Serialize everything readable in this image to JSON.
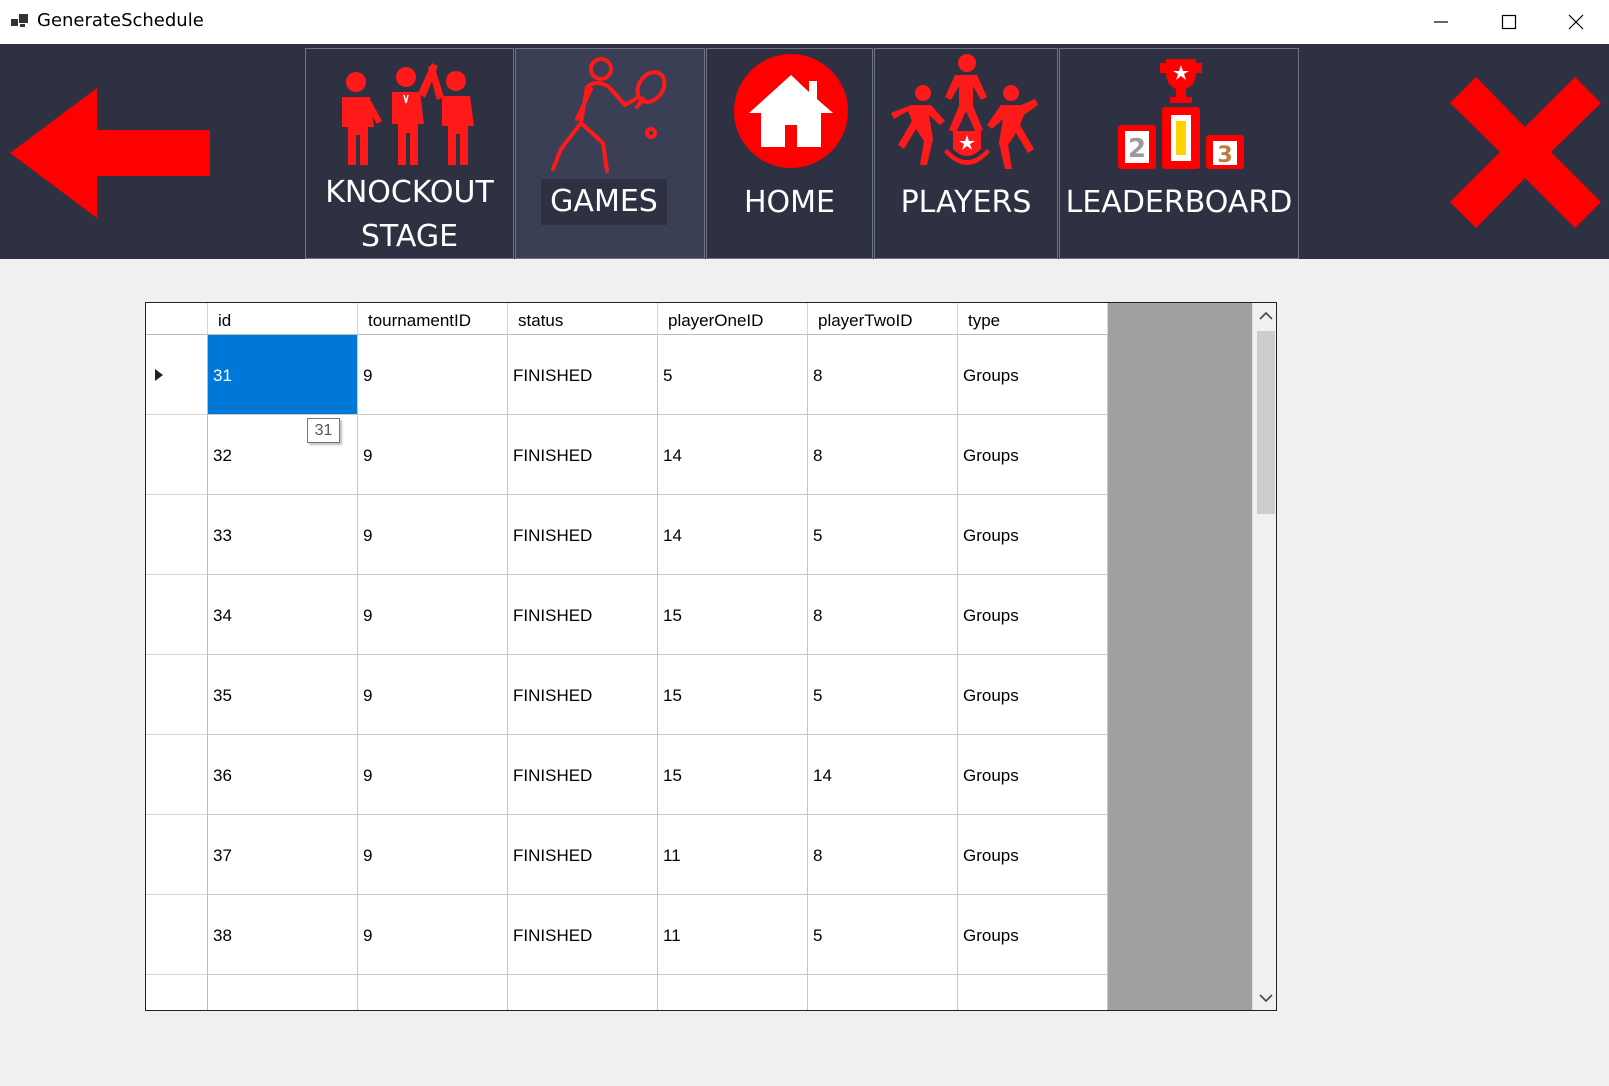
{
  "window": {
    "title": "GenerateSchedule",
    "minimize_icon": "minimize-icon",
    "maximize_icon": "maximize-icon",
    "close_icon": "close-icon"
  },
  "nav": {
    "back_icon": "arrow-left-icon",
    "exit_icon": "red-x-icon",
    "tiles": [
      {
        "label_line1": "KNOCKOUT",
        "label_line2": "STAGE",
        "icon": "people-celebrating-icon",
        "active": false
      },
      {
        "label": "GAMES",
        "icon": "tennis-player-icon",
        "active": true
      },
      {
        "label": "HOME",
        "icon": "home-icon",
        "active": false
      },
      {
        "label": "PLAYERS",
        "icon": "players-icon",
        "active": false
      },
      {
        "label": "LEADERBOARD",
        "icon": "podium-icon",
        "active": false
      }
    ],
    "accent_color": "#ff0000",
    "background_color": "#2d3142"
  },
  "grid": {
    "columns": [
      "id",
      "tournamentID",
      "status",
      "playerOneID",
      "playerTwoID",
      "type"
    ],
    "rows": [
      [
        "31",
        "9",
        "FINISHED",
        "5",
        "8",
        "Groups"
      ],
      [
        "32",
        "9",
        "FINISHED",
        "14",
        "8",
        "Groups"
      ],
      [
        "33",
        "9",
        "FINISHED",
        "14",
        "5",
        "Groups"
      ],
      [
        "34",
        "9",
        "FINISHED",
        "15",
        "8",
        "Groups"
      ],
      [
        "35",
        "9",
        "FINISHED",
        "15",
        "5",
        "Groups"
      ],
      [
        "36",
        "9",
        "FINISHED",
        "15",
        "14",
        "Groups"
      ],
      [
        "37",
        "9",
        "FINISHED",
        "11",
        "8",
        "Groups"
      ],
      [
        "38",
        "9",
        "FINISHED",
        "11",
        "5",
        "Groups"
      ]
    ],
    "selected_row": 0,
    "selected_column": 0,
    "tooltip": "31",
    "selection_color": "#0078d7"
  }
}
